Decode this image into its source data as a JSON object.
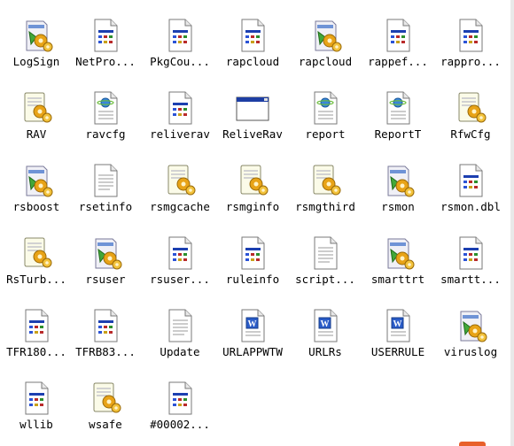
{
  "files": [
    {
      "label": "LogSign",
      "icon": "setup-app-icon"
    },
    {
      "label": "NetPro...",
      "icon": "dll-file-icon"
    },
    {
      "label": "PkgCou...",
      "icon": "dll-file-icon"
    },
    {
      "label": "rapcloud",
      "icon": "dll-file-icon"
    },
    {
      "label": "rapcloud",
      "icon": "setup-app-icon"
    },
    {
      "label": "rappef...",
      "icon": "dll-file-icon"
    },
    {
      "label": "rappro...",
      "icon": "dll-file-icon"
    },
    {
      "label": "RAV",
      "icon": "setup-scroll-icon"
    },
    {
      "label": "ravcfg",
      "icon": "config-globe-icon"
    },
    {
      "label": "reliverav",
      "icon": "dll-file-icon"
    },
    {
      "label": "ReliveRav",
      "icon": "window-app-icon"
    },
    {
      "label": "report",
      "icon": "config-globe-icon"
    },
    {
      "label": "ReportT",
      "icon": "config-globe-icon"
    },
    {
      "label": "RfwCfg",
      "icon": "setup-scroll-icon"
    },
    {
      "label": "rsboost",
      "icon": "setup-app-icon"
    },
    {
      "label": "rsetinfo",
      "icon": "text-file-icon"
    },
    {
      "label": "rsmgcache",
      "icon": "setup-scroll-icon"
    },
    {
      "label": "rsmginfo",
      "icon": "setup-scroll-icon"
    },
    {
      "label": "rsmgthird",
      "icon": "setup-scroll-icon"
    },
    {
      "label": "rsmon",
      "icon": "setup-app-icon"
    },
    {
      "label": "rsmon.dbl",
      "icon": "dll-file-icon"
    },
    {
      "label": "RsTurb...",
      "icon": "setup-scroll-icon"
    },
    {
      "label": "rsuser",
      "icon": "setup-app-icon"
    },
    {
      "label": "rsuser...",
      "icon": "dll-file-icon"
    },
    {
      "label": "ruleinfo",
      "icon": "dll-file-icon"
    },
    {
      "label": "script...",
      "icon": "text-file-icon"
    },
    {
      "label": "smarttrt",
      "icon": "setup-app-icon"
    },
    {
      "label": "smartt...",
      "icon": "dll-file-icon"
    },
    {
      "label": "TFR180...",
      "icon": "dll-file-icon"
    },
    {
      "label": "TFRB83...",
      "icon": "dll-file-icon"
    },
    {
      "label": "Update",
      "icon": "text-file-icon"
    },
    {
      "label": "URLAPPWTW",
      "icon": "word-doc-icon"
    },
    {
      "label": "URLRs",
      "icon": "word-doc-icon"
    },
    {
      "label": "USERRULE",
      "icon": "word-doc-icon"
    },
    {
      "label": "viruslog",
      "icon": "setup-app-icon"
    },
    {
      "label": "wllib",
      "icon": "dll-file-icon"
    },
    {
      "label": "wsafe",
      "icon": "setup-scroll-icon"
    },
    {
      "label": "#00002...",
      "icon": "dll-file-icon"
    }
  ]
}
